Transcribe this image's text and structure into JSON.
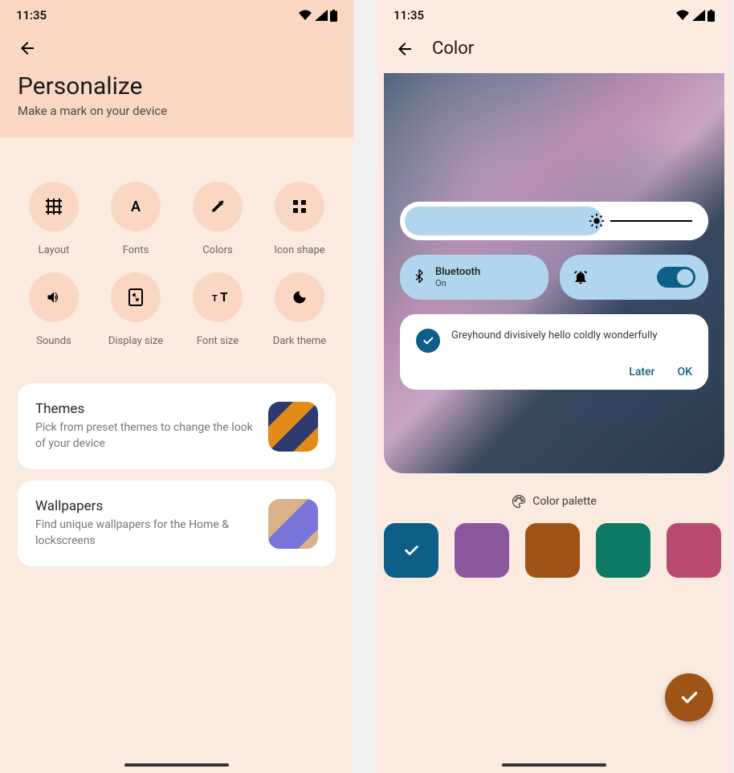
{
  "status": {
    "time": "11:35"
  },
  "screen1": {
    "title": "Personalize",
    "subtitle": "Make a mark on your device",
    "tiles": [
      {
        "label": "Layout",
        "icon": "grid-icon"
      },
      {
        "label": "Fonts",
        "icon": "font-icon"
      },
      {
        "label": "Colors",
        "icon": "dropper-icon"
      },
      {
        "label": "Icon shape",
        "icon": "shapes-icon"
      },
      {
        "label": "Sounds",
        "icon": "volume-icon"
      },
      {
        "label": "Display size",
        "icon": "display-size-icon"
      },
      {
        "label": "Font size",
        "icon": "font-size-icon"
      },
      {
        "label": "Dark theme",
        "icon": "moon-icon"
      }
    ],
    "cards": {
      "themes": {
        "title": "Themes",
        "desc": "Pick from preset themes to change the look of your device"
      },
      "wallpapers": {
        "title": "Wallpapers",
        "desc": "Find unique wallpapers for the Home & lockscreens"
      }
    }
  },
  "screen2": {
    "title": "Color",
    "preview": {
      "bluetooth": {
        "label": "Bluetooth",
        "state": "On"
      },
      "dialog": {
        "text": "Greyhound divisively hello coldly wonderfully",
        "later": "Later",
        "ok": "OK"
      }
    },
    "palette_label": "Color palette",
    "swatches": [
      {
        "color": "#0d5f88",
        "selected": true
      },
      {
        "color": "#8c579f",
        "selected": false
      },
      {
        "color": "#9e5417",
        "selected": false
      },
      {
        "color": "#0c7a64",
        "selected": false
      },
      {
        "color": "#b84a72",
        "selected": false
      }
    ]
  }
}
